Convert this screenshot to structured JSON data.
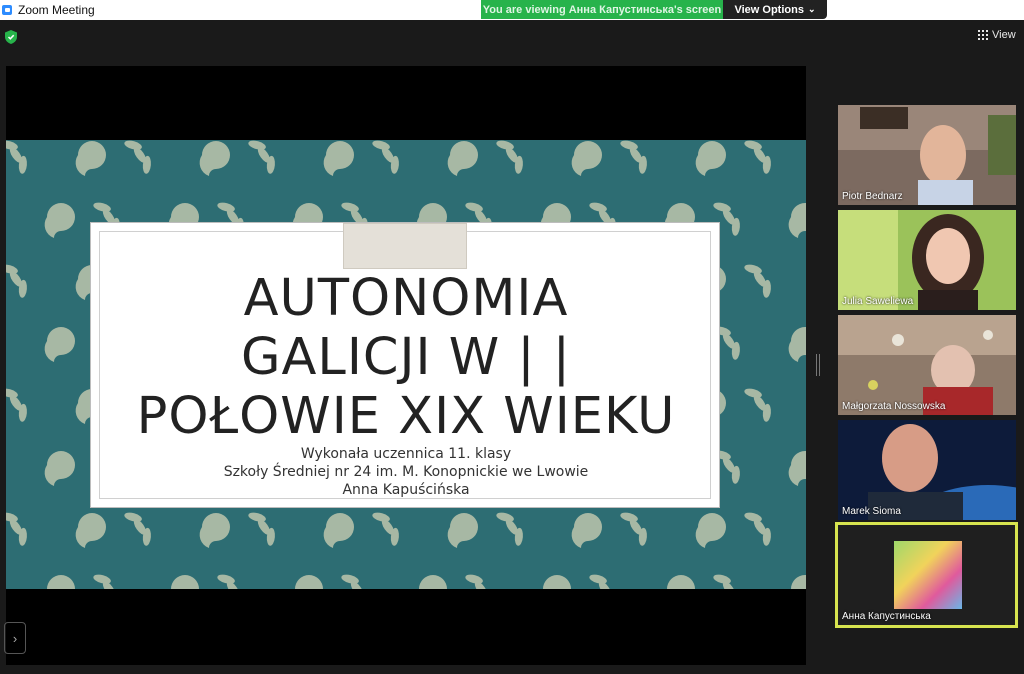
{
  "window": {
    "title": "Zoom Meeting"
  },
  "share_banner": {
    "message": "You are viewing Анна Капустинська's screen",
    "options_label": "View Options"
  },
  "toolbar": {
    "view_label": "View"
  },
  "slide": {
    "title_lines": [
      "AUTONOMIA",
      "GALICJI W | |",
      "POŁOWIE XIX WIEKU"
    ],
    "subtitle_lines": [
      "Wykonała uczennica 11. klasy",
      "Szkoły Średniej nr 24 im. M. Konopnickie we Lwowie",
      "Anna Kapuścińska"
    ],
    "background_color": "#2d6d73",
    "pattern_color": "#a7b8a4"
  },
  "participants": [
    {
      "name": "Piotr Bednarz"
    },
    {
      "name": "Julia Saweliewa"
    },
    {
      "name": "Małgorzata Nossowska"
    },
    {
      "name": "Marek Sioma"
    },
    {
      "name": "Анна Капустинська",
      "active_speaker": true
    }
  ],
  "colors": {
    "banner_green": "#27b34b",
    "active_border": "#d7e44f",
    "shield_green": "#27b34b"
  }
}
